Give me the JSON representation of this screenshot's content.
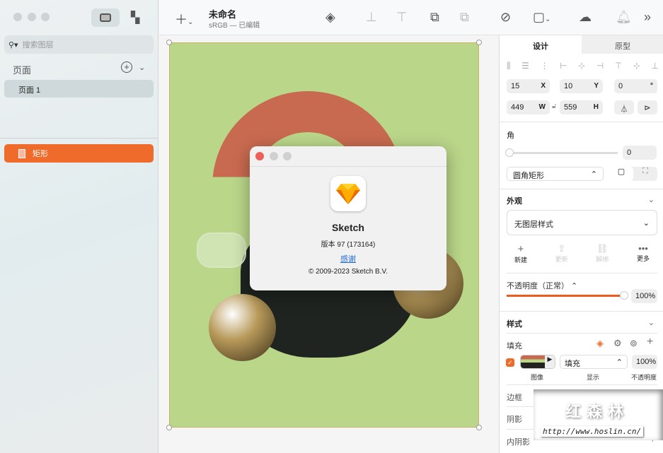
{
  "sidebar": {
    "search_placeholder": "搜索图层",
    "pages_header": "页面",
    "pages": [
      "页面 1"
    ],
    "layers": [
      "矩形"
    ]
  },
  "toolbar": {
    "doc_title": "未命名",
    "doc_subtitle": "sRGB — 已编辑"
  },
  "dialog": {
    "app_name": "Sketch",
    "version": "版本 97 (173164)",
    "thanks_link": "感谢",
    "copyright": "© 2009-2023 Sketch B.V."
  },
  "panel": {
    "tabs": [
      "设计",
      "原型"
    ],
    "x": "15",
    "x_label": "X",
    "y": "10",
    "y_label": "Y",
    "rotation": "0",
    "rotation_label": "°",
    "w": "449",
    "w_label": "W",
    "h": "559",
    "h_label": "H",
    "corner_header": "角",
    "corner_value": "0",
    "corner_value_fraction": 0,
    "corner_style": "圆角矩形",
    "appearance_header": "外观",
    "layer_style": "无图层样式",
    "style_actions": [
      "新建",
      "更新",
      "解绑",
      "更多"
    ],
    "opacity_label": "不透明度（正常）",
    "opacity_value": "100%",
    "opacity_fraction": 1.0,
    "style_header": "样式",
    "fill_label": "填充",
    "fill_type": "填充",
    "fill_opacity": "100%",
    "fill_captions": [
      "图像",
      "显示",
      "不透明度"
    ],
    "border_label": "边框",
    "shadow_label": "阴影",
    "inner_shadow_label": "内阴影"
  },
  "watermark": {
    "title": "红森林",
    "url": "http://www.hoslin.cn/"
  },
  "colors": {
    "accent": "#ef6b2c",
    "artboard": "#bad689"
  }
}
